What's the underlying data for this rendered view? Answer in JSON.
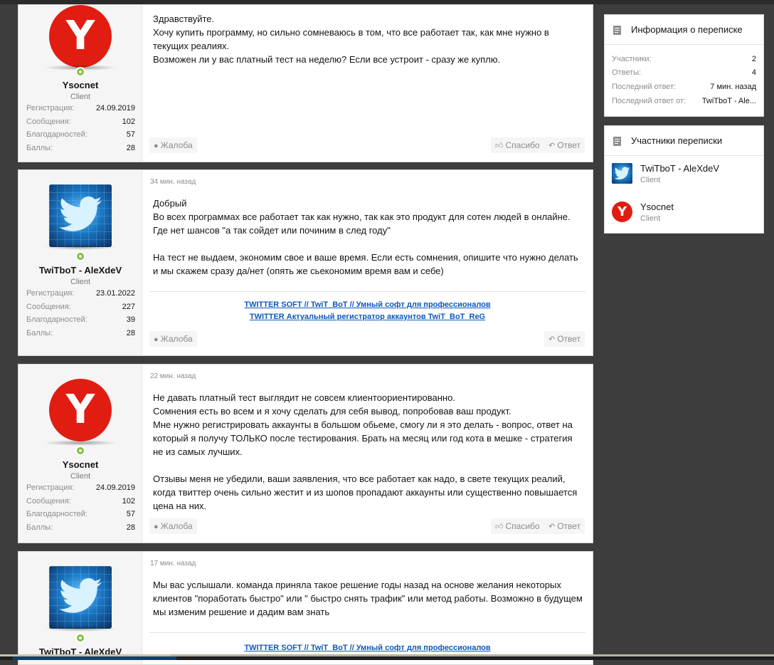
{
  "posts": [
    {
      "author": "Ysocnet",
      "role": "Client",
      "avatar": "yandex-y-avatar",
      "stats": [
        {
          "k": "Регистрация:",
          "v": "24.09.2019"
        },
        {
          "k": "Сообщения:",
          "v": "102"
        },
        {
          "k": "Благодарностей:",
          "v": "57"
        },
        {
          "k": "Баллы:",
          "v": "28"
        }
      ],
      "time": "",
      "text": "Здравствуйте.\nХочу купить программу, но сильно сомневаюсь в том, что все работает так, как мне нужно в текущих реалиях.\nВозможен ли у вас платный тест на неделю? Если все устроит - сразу же куплю.",
      "report": "Жалоба",
      "like": "Спасибо",
      "reply": "Ответ"
    },
    {
      "author": "TwiTboT - AleXdeV",
      "role": "Client",
      "avatar": "twitter-bird-avatar",
      "stats": [
        {
          "k": "Регистрация:",
          "v": "23.01.2022"
        },
        {
          "k": "Сообщения:",
          "v": "227"
        },
        {
          "k": "Благодарностей:",
          "v": "39"
        },
        {
          "k": "Баллы:",
          "v": "28"
        }
      ],
      "time": "34 мин. назад",
      "text": "Добрый\nВо всех программах все работает так как нужно, так как это продукт для сотен людей в онлайне.\nГде нет шансов \"а так сойдет или починим в след году\"\n\nНа тест не выдаем, экономим свое и ваше время. Если есть сомнения, опишите что нужно делать и мы скажем сразу да/нет (опять же сьекономим время вам и себе)",
      "sig1": "TWITTER SOFT // TwiT_BoT // Умный софт для профессионалов",
      "sig2": "TWITTER Актуальный регистратор аккаунтов TwiT_BoT_ReG",
      "report": "Жалоба",
      "reply": "Ответ"
    },
    {
      "author": "Ysocnet",
      "role": "Client",
      "avatar": "yandex-y-avatar",
      "stats": [
        {
          "k": "Регистрация:",
          "v": "24.09.2019"
        },
        {
          "k": "Сообщения:",
          "v": "102"
        },
        {
          "k": "Благодарностей:",
          "v": "57"
        },
        {
          "k": "Баллы:",
          "v": "28"
        }
      ],
      "time": "22 мин. назад",
      "text": "Не давать платный тест выглядит не совсем клиентоориентированно.\nСомнения есть во всем и я хочу сделать для себя вывод, попробовав ваш продукт.\nМне нужно регистрировать аккаунты в большом обьеме, смогу ли я это делать - вопрос, ответ на который я получу ТОЛЬКО после тестирования. Брать на месяц или год кота в мешке - стратегия не из самых лучших.\n\nОтзывы меня не убедили, ваши заявления, что все работает как надо, в свете текущих реалий, когда твиттер очень сильно жестит и из шопов пропадают аккаунты или существенно повышается цена на них.",
      "report": "Жалоба",
      "like": "Спасибо",
      "reply": "Ответ"
    },
    {
      "author": "TwiTboT - AleXdeV",
      "avatar": "twitter-bird-avatar",
      "time": "17 мин. назад",
      "text": "Мы вас услышали. команда приняла такое решение годы назад на основе желания некоторых клиентов \"поработать быстро\" или \" быстро снять трафик\" или метод работы. Возможно в будущем мы изменим решение и дадим вам знать",
      "sig1": "TWITTER SOFT // TwiT_BoT // Умный софт для профессионалов"
    }
  ],
  "sidebar": {
    "info": {
      "title": "Информация о переписке",
      "rows": [
        {
          "k": "Участники:",
          "v": "2"
        },
        {
          "k": "Ответы:",
          "v": "4"
        },
        {
          "k": "Последний ответ:",
          "v": "7 мин. назад"
        },
        {
          "k": "Последний ответ от:",
          "v": "TwiTboT - Ale..."
        }
      ]
    },
    "participants": {
      "title": "Участники переписки",
      "members": [
        {
          "name": "TwiTboT - AleXdeV",
          "role": "Client",
          "avatar": "twitter-bird-avatar"
        },
        {
          "name": "Ysocnet",
          "role": "Client",
          "avatar": "yandex-y-avatar"
        }
      ]
    }
  },
  "colors": {
    "background": "#3d3d3d",
    "link": "#0b58bd",
    "yandex_red": "#e11d12",
    "online": "#7fbf3f"
  }
}
